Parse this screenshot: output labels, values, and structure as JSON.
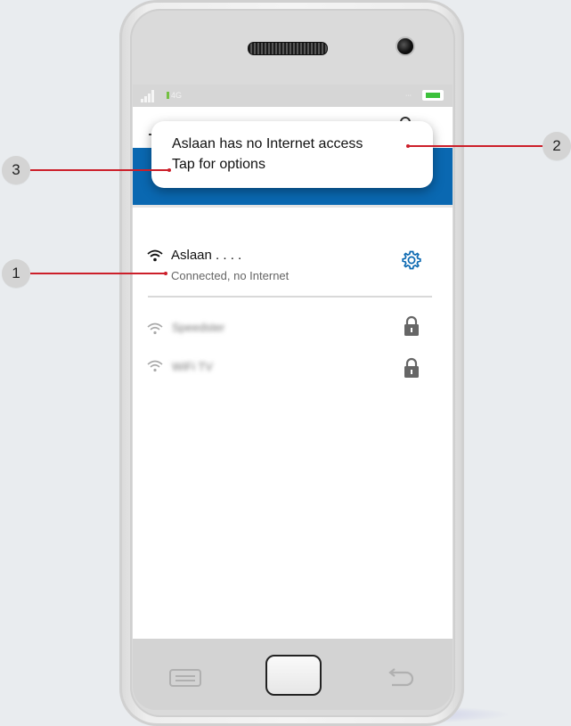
{
  "status_bar": {
    "network_label": "4G",
    "battery_icon": "battery-icon",
    "signal_icon": "signal-icon"
  },
  "toast": {
    "line1": "Aslaan  has no Internet access",
    "line2": "Tap for options"
  },
  "wifi_list": {
    "connected": {
      "name": "Aslaan . . . .",
      "status": "Connected, no Internet",
      "icon": "wifi-icon",
      "action_icon": "gear-icon"
    },
    "others": [
      {
        "name": "Speedster",
        "icon": "wifi-icon",
        "action_icon": "lock-icon"
      },
      {
        "name": "WiFi TV",
        "icon": "wifi-icon",
        "action_icon": "lock-icon"
      }
    ]
  },
  "nav_bar": {
    "menu_icon": "menu-icon",
    "home_icon": "home-button",
    "back_icon": "back-icon"
  },
  "callouts": [
    "1",
    "2",
    "3"
  ],
  "colors": {
    "header_blue": "#0a68b1",
    "gear_blue": "#0a68b1",
    "callout_line": "#cc1f2a",
    "battery_green": "#3cc13b"
  }
}
